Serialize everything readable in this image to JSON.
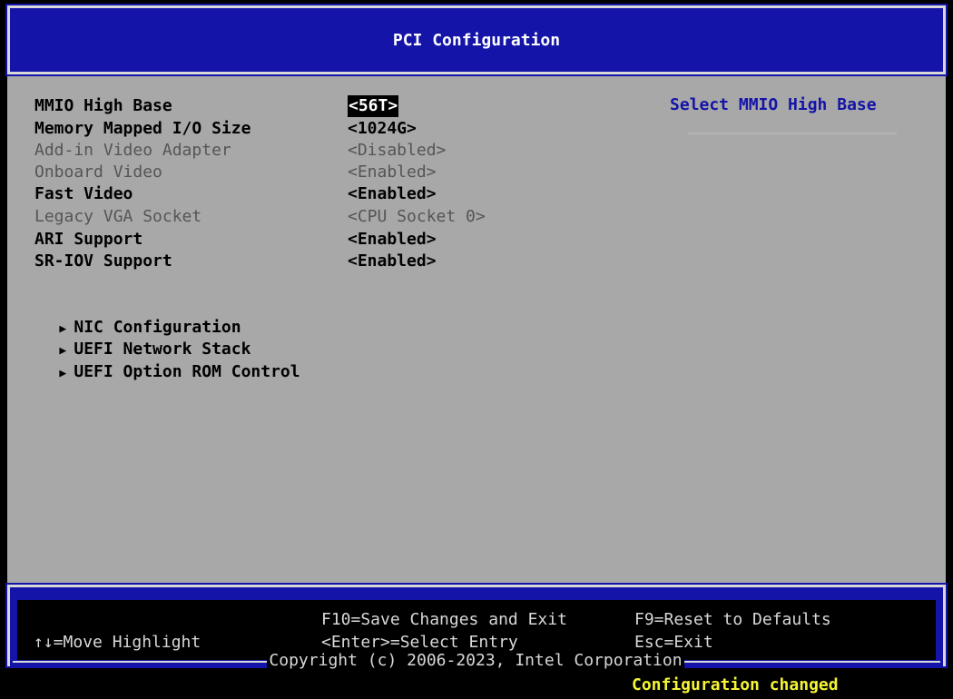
{
  "title": "PCI Configuration",
  "settings": [
    {
      "label": "MMIO High Base",
      "value": "<56T>",
      "disabled": false,
      "selected": true
    },
    {
      "label": "Memory Mapped I/O Size",
      "value": "<1024G>",
      "disabled": false,
      "selected": false
    },
    {
      "label": "Add-in Video Adapter",
      "value": "<Disabled>",
      "disabled": true,
      "selected": false
    },
    {
      "label": "Onboard Video",
      "value": "<Enabled>",
      "disabled": true,
      "selected": false
    },
    {
      "label": "Fast Video",
      "value": "<Enabled>",
      "disabled": false,
      "selected": false
    },
    {
      "label": "Legacy VGA Socket",
      "value": "<CPU Socket 0>",
      "disabled": true,
      "selected": false
    },
    {
      "label": "ARI Support",
      "value": "<Enabled>",
      "disabled": false,
      "selected": false
    },
    {
      "label": "SR-IOV Support",
      "value": "<Enabled>",
      "disabled": false,
      "selected": false
    }
  ],
  "submenus": [
    {
      "label": "NIC Configuration"
    },
    {
      "label": "UEFI Network Stack"
    },
    {
      "label": "UEFI Option ROM Control"
    }
  ],
  "help_text": "Select MMIO High Base",
  "footer": {
    "move": "↑↓=Move Highlight",
    "f10": "F10=Save Changes and Exit",
    "enter": "<Enter>=Select Entry",
    "f9": "F9=Reset to Defaults",
    "esc": "Esc=Exit",
    "copyright": "Copyright (c) 2006-2023, Intel Corporation"
  },
  "status": "Configuration changed",
  "colors": {
    "title_bg": "#1414a8",
    "main_bg": "#a8a8a8",
    "help_text": "#1414a8",
    "status_text": "#f4f434"
  }
}
